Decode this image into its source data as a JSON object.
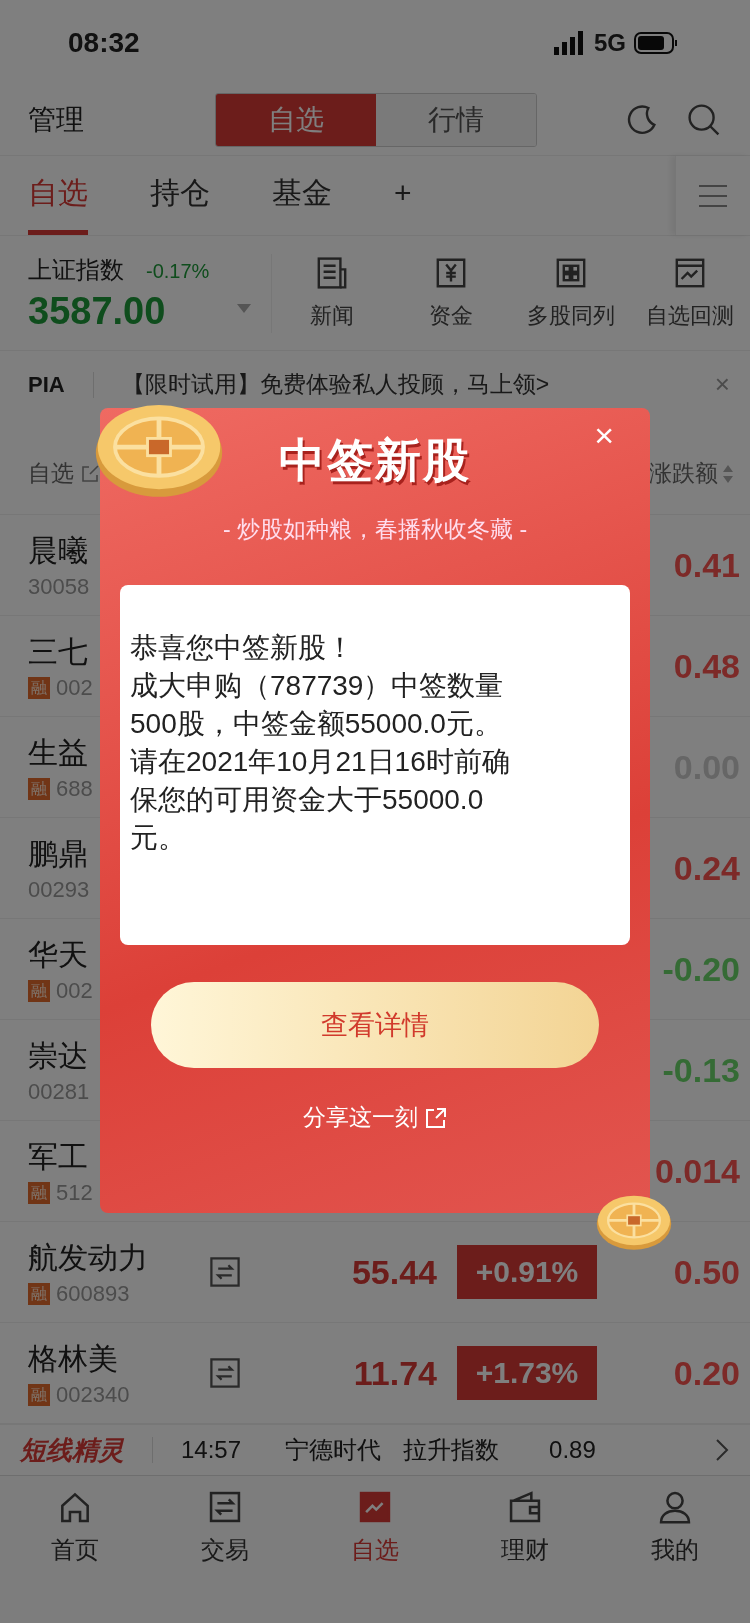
{
  "status_bar": {
    "time": "08:32",
    "network": "5G"
  },
  "header": {
    "left": "管理",
    "segments": [
      {
        "label": "自选",
        "selected": true
      },
      {
        "label": "行情",
        "selected": false
      }
    ]
  },
  "tabs": [
    {
      "label": "自选",
      "selected": true
    },
    {
      "label": "持仓",
      "selected": false
    },
    {
      "label": "基金",
      "selected": false
    },
    {
      "label": "+",
      "selected": false
    }
  ],
  "index": {
    "name": "上证指数",
    "change": "-0.17%",
    "value": "3587.00"
  },
  "quick_actions": [
    {
      "kind": "news",
      "label": "新闻"
    },
    {
      "kind": "funds",
      "label": "资金"
    },
    {
      "kind": "grid",
      "label": "多股同列"
    },
    {
      "kind": "chart",
      "label": "自选回测"
    }
  ],
  "banner": {
    "tag": "PIA",
    "text": "【限时试用】免费体验私人投顾，马上领>",
    "close": "×"
  },
  "table": {
    "columns": [
      {
        "label": "自选"
      },
      {
        "label": "涨跌额"
      }
    ],
    "rows": [
      {
        "kind": "partial",
        "name": "晨曦",
        "code": "30058",
        "change": "0.41",
        "color": "#7d2a28"
      },
      {
        "kind": "partial",
        "name": "三七",
        "badge": "融",
        "code": "002",
        "change": "0.48",
        "color": "#7d2a28"
      },
      {
        "kind": "partial",
        "name": "生益",
        "badge": "融",
        "code": "688",
        "change": "0.00",
        "color": "#666666"
      },
      {
        "kind": "partial",
        "name": "鹏鼎",
        "code": "00293",
        "change": "0.24",
        "color": "#7d2a28"
      },
      {
        "kind": "partial",
        "name": "华天",
        "badge": "融",
        "code": "002",
        "change": "-0.20",
        "color": "#356b35"
      },
      {
        "kind": "partial",
        "name": "崇达",
        "code": "00281",
        "change": "-0.13",
        "color": "#356b35"
      },
      {
        "kind": "partial",
        "name": "军工",
        "badge": "融",
        "code": "512",
        "change": "0.014",
        "color": "#7d2a28"
      },
      {
        "kind": "full",
        "name": "航发动力",
        "badge": "融",
        "code": "600893",
        "price": "55.44",
        "percent": "+0.91%",
        "change": "0.50",
        "color": "#7d2a28"
      },
      {
        "kind": "full",
        "name": "格林美",
        "badge": "融",
        "code": "002340",
        "price": "11.74",
        "percent": "+1.73%",
        "change": "0.20",
        "color": "#7d2a28"
      }
    ]
  },
  "ticker": {
    "title": "短线精灵",
    "time": "14:57",
    "stock": "宁德时代",
    "signal": "拉升指数",
    "value": "0.89"
  },
  "bottom_nav": [
    {
      "kind": "home",
      "label": "首页",
      "selected": false
    },
    {
      "kind": "trade",
      "label": "交易",
      "selected": false
    },
    {
      "kind": "watch",
      "label": "自选",
      "selected": true
    },
    {
      "kind": "wallet",
      "label": "理财",
      "selected": false
    },
    {
      "kind": "user",
      "label": "我的",
      "selected": false
    }
  ],
  "dialog": {
    "title": "中签新股",
    "subtitle": "- 炒股如种粮，春播秋收冬藏 -",
    "message": [
      "恭喜您中签新股！",
      "成大申购（787739）中签数量500股，中签金额55000.0元。",
      "请在2021年10月21日16时前确保您的可用资金大于55000.0元。"
    ],
    "button": "查看详情",
    "share": "分享这一刻",
    "close": "×"
  }
}
